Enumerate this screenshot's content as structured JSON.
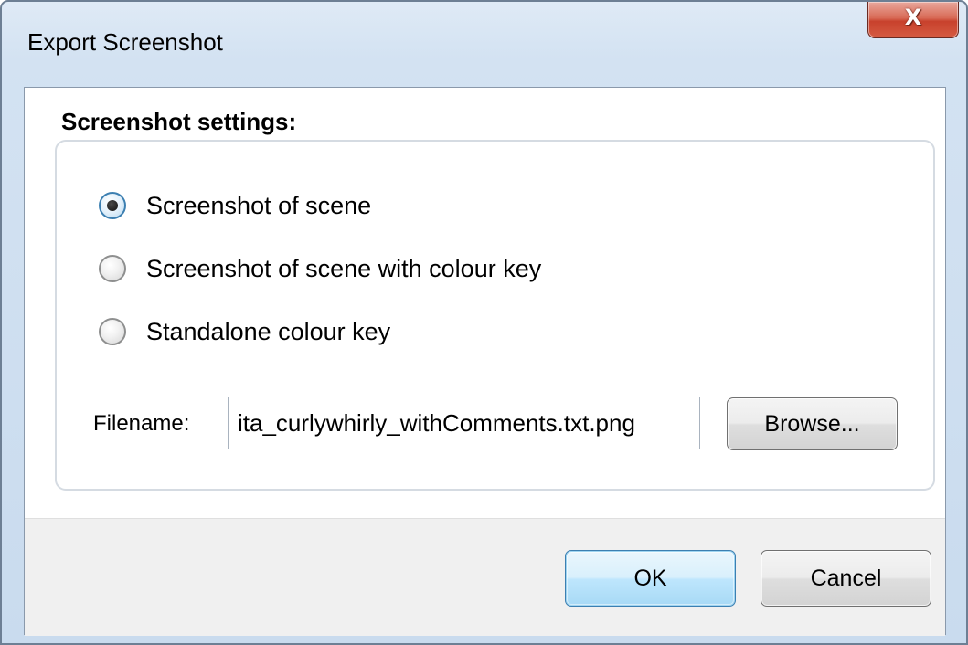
{
  "window": {
    "title": "Export Screenshot",
    "close_glyph": "X"
  },
  "settings": {
    "group_title": "Screenshot settings:",
    "options": [
      {
        "label": "Screenshot of scene",
        "checked": true
      },
      {
        "label": "Screenshot of scene with colour key",
        "checked": false
      },
      {
        "label": "Standalone colour key",
        "checked": false
      }
    ],
    "filename_label": "Filename:",
    "filename_value": "ita_curlywhirly_withComments.txt.png",
    "browse_label": "Browse..."
  },
  "footer": {
    "ok_label": "OK",
    "cancel_label": "Cancel"
  },
  "colors": {
    "titlebar": "#d3e2f2",
    "close_button": "#c8412c",
    "ok_button": "#bee6fd",
    "footer": "#f0f0f0"
  },
  "icons": {
    "close": "close-icon",
    "radio_checked": "radio-checked-icon",
    "radio_unchecked": "radio-unchecked-icon"
  }
}
